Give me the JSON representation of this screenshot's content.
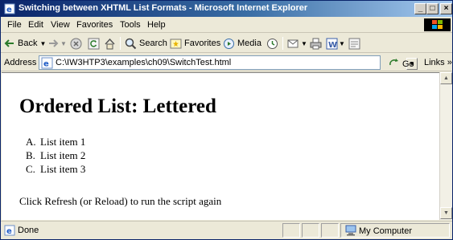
{
  "window": {
    "title": "Switching between XHTML List Formats - Microsoft Internet Explorer",
    "controls": {
      "minimize": "_",
      "maximize": "□",
      "close": "×"
    }
  },
  "menu": [
    "File",
    "Edit",
    "View",
    "Favorites",
    "Tools",
    "Help"
  ],
  "toolbar": {
    "back": "Back",
    "search": "Search",
    "favorites": "Favorites",
    "media": "Media"
  },
  "address": {
    "label": "Address",
    "url": "C:\\IW3HTP3\\examples\\ch09\\SwitchTest.html",
    "go": "Go",
    "links": "Links »"
  },
  "page": {
    "heading": "Ordered List: Lettered",
    "list": [
      {
        "marker": "A.",
        "text": "List item 1"
      },
      {
        "marker": "B.",
        "text": "List item 2"
      },
      {
        "marker": "C.",
        "text": "List item 3"
      }
    ],
    "footer_text": "Click Refresh (or Reload) to run the script again"
  },
  "status": {
    "text": "Done",
    "zone": "My Computer"
  },
  "colors": {
    "titlebar_start": "#0a246a",
    "titlebar_end": "#a6caf0",
    "chrome": "#ece9d8"
  },
  "icons": {
    "title": "ie-page-icon",
    "back": "back-arrow-icon",
    "forward": "forward-arrow-icon",
    "stop": "stop-icon",
    "refresh": "refresh-icon",
    "home": "home-icon",
    "search": "search-icon",
    "favorites": "favorites-icon",
    "media": "media-icon",
    "history": "history-icon",
    "mail": "mail-icon",
    "print": "print-icon",
    "word": "word-icon",
    "discuss": "discuss-icon",
    "windows_logo": "windows-logo-icon",
    "status_page": "page-icon",
    "my_computer": "my-computer-icon"
  }
}
